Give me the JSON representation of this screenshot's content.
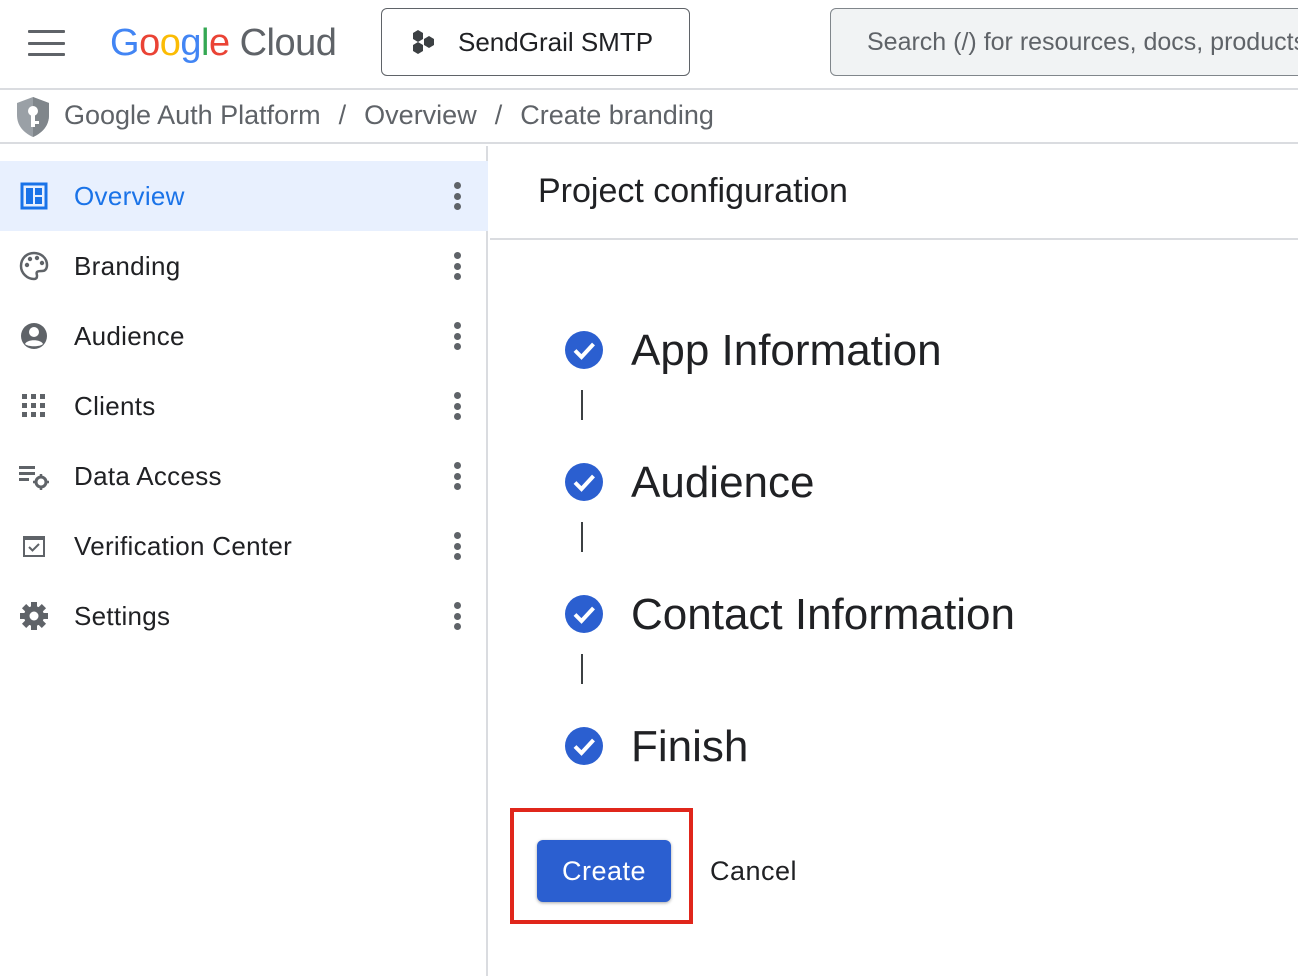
{
  "header": {
    "logo": {
      "google": [
        "G",
        "o",
        "o",
        "g",
        "l",
        "e"
      ],
      "product": "Cloud"
    },
    "project_selector": {
      "label": "SendGrail SMTP"
    },
    "search": {
      "placeholder": "Search (/) for resources, docs, products, and more"
    }
  },
  "breadcrumb": {
    "items": [
      "Google Auth Platform",
      "Overview",
      "Create branding"
    ],
    "separator": "/"
  },
  "sidebar": {
    "items": [
      {
        "label": "Overview",
        "icon": "dashboard-icon",
        "active": true
      },
      {
        "label": "Branding",
        "icon": "palette-icon",
        "active": false
      },
      {
        "label": "Audience",
        "icon": "account-circle-icon",
        "active": false
      },
      {
        "label": "Clients",
        "icon": "apps-grid-icon",
        "active": false
      },
      {
        "label": "Data Access",
        "icon": "list-settings-icon",
        "active": false
      },
      {
        "label": "Verification Center",
        "icon": "checkbox-icon",
        "active": false
      },
      {
        "label": "Settings",
        "icon": "gear-icon",
        "active": false
      }
    ]
  },
  "main": {
    "title": "Project configuration",
    "steps": [
      {
        "label": "App Information",
        "status": "complete"
      },
      {
        "label": "Audience",
        "status": "complete"
      },
      {
        "label": "Contact Information",
        "status": "complete"
      },
      {
        "label": "Finish",
        "status": "complete"
      }
    ],
    "actions": {
      "create_label": "Create",
      "cancel_label": "Cancel"
    }
  },
  "colors": {
    "primary": "#2b5fd0",
    "active_nav_bg": "#e8f0fe",
    "active_nav_text": "#1a73e8",
    "step_check": "#2b5fd0",
    "highlight_border": "#e0261b"
  }
}
